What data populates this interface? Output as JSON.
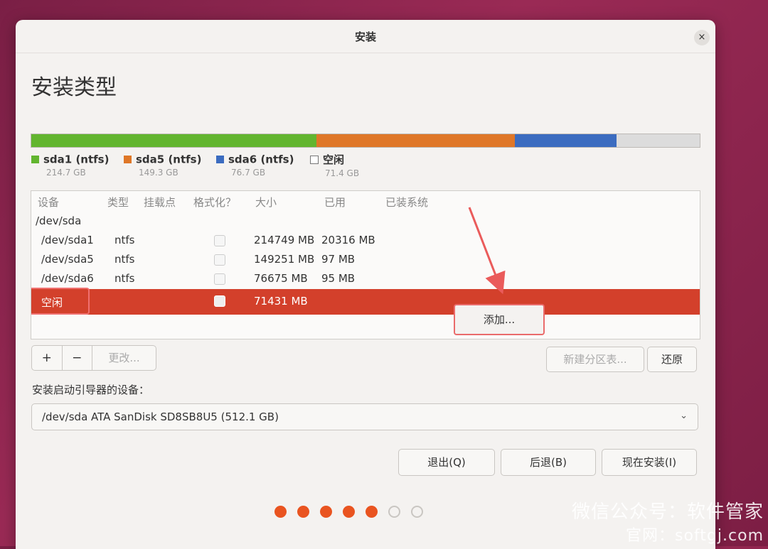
{
  "window": {
    "title": "安装",
    "close_glyph": "×"
  },
  "page_title": "安装类型",
  "usage_bar": [
    {
      "name": "sda1 (ntfs)",
      "size": "214.7 GB",
      "color": "#62b52f",
      "fraction": 0.4266
    },
    {
      "name": "sda5 (ntfs)",
      "size": "149.3 GB",
      "color": "#df7728",
      "fraction": 0.2966
    },
    {
      "name": "sda6 (ntfs)",
      "size": "76.7 GB",
      "color": "#3b6cc0",
      "fraction": 0.1524
    },
    {
      "name": "空闲",
      "size": "71.4 GB",
      "color": "#dcdcdc",
      "fraction": 0.1244
    }
  ],
  "table": {
    "headers": {
      "device": "设备",
      "type": "类型",
      "mount": "挂载点",
      "format": "格式化？",
      "size": "大小",
      "used": "已用",
      "installed": "已装系统"
    },
    "disk": "/dev/sda",
    "rows": [
      {
        "device": "/dev/sda1",
        "type": "ntfs",
        "format": false,
        "size": "214749 MB",
        "used": "20316 MB"
      },
      {
        "device": "/dev/sda5",
        "type": "ntfs",
        "format": false,
        "size": "149251 MB",
        "used": "97 MB"
      },
      {
        "device": "/dev/sda6",
        "type": "ntfs",
        "format": false,
        "size": "76675 MB",
        "used": "95 MB"
      }
    ],
    "free_row": {
      "device": "空闲",
      "size": "71431 MB",
      "selected": true
    }
  },
  "popup": {
    "add_label": "添加..."
  },
  "partition_buttons": {
    "add": "+",
    "remove": "−",
    "change": "更改..."
  },
  "table_buttons": {
    "new_table": "新建分区表...",
    "revert": "还原"
  },
  "bootloader": {
    "label": "安装启动引导器的设备：",
    "selected": "/dev/sda   ATA SanDisk SD8SB8U5 (512.1 GB)",
    "chevron": "⌄"
  },
  "nav_buttons": {
    "quit": "退出(Q)",
    "back": "后退(B)",
    "install_now": "现在安装(I)"
  },
  "progress": {
    "total_steps": 7,
    "completed_steps": 5
  },
  "watermark": {
    "line1": "微信公众号：软件管家",
    "line2": "官网：softgj.com"
  }
}
